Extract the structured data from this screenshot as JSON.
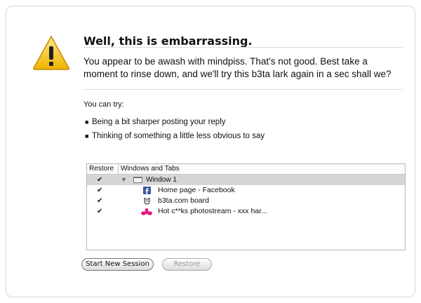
{
  "error": {
    "title": "Well, this is embarrassing.",
    "message": "You appear to be awash with mindpiss.  That's not good.  Best take a moment to rinse down, and we'll try this b3ta lark again in a sec shall we?",
    "try_label": "You can try:",
    "suggestions": [
      "Being a bit sharper posting your reply",
      "Thinking of something a little less obvious to say"
    ]
  },
  "tree": {
    "headers": {
      "restore": "Restore",
      "windows": "Windows and Tabs"
    },
    "window": {
      "label": "Window 1",
      "checked": true
    },
    "tabs": [
      {
        "label": "Home page - Facebook",
        "icon": "facebook-icon",
        "checked": true
      },
      {
        "label": "b3ta.com board",
        "icon": "b3ta-icon",
        "checked": true
      },
      {
        "label": "Hot c**ks photostream - xxx har...",
        "icon": "flickr-icon",
        "checked": true
      }
    ],
    "check_glyph": "✔",
    "arrow_glyph": "▼"
  },
  "buttons": {
    "start_new": "Start New Session",
    "restore": "Restore"
  },
  "colors": {
    "warning_fill": "#f5c518",
    "facebook": "#3b5998",
    "flickr_pink": "#e0197d"
  }
}
